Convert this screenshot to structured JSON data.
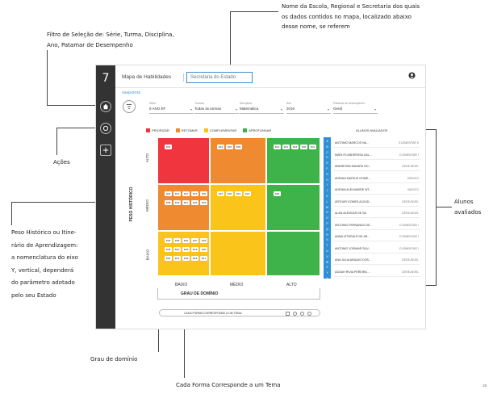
{
  "annotations": {
    "top_right": [
      "Nome da Escola, Regional e Secretaria dos quais",
      "os dados contidos no mapa, localizado abaixo",
      "desse nome, se referem"
    ],
    "top_left": [
      "Filtro de Seleção de: Série, Turma, Disciplina,",
      "Ano, Patamar de Desempenho"
    ],
    "acoes": "Ações",
    "alunos": [
      "Alunos",
      "avaliados"
    ],
    "peso": [
      "Peso Histórico ou Itine-",
      "rário de Aprendizagem:",
      "a nomenclatura do eixo",
      "Y, vertical, dependerá",
      "do parâmetro adotado",
      "pelo seu Estado"
    ],
    "grau": "Grau de domínio",
    "forma": "Cada Forma Corresponde a um Tema"
  },
  "app": {
    "logo": "7",
    "title": "Mapa de Habilidades",
    "school_placeholder": "Secretaria do Estado",
    "breadcrumb": "Saepe2016"
  },
  "filters": [
    {
      "label": "Série",
      "value": "9 ANO EF"
    },
    {
      "label": "Turmas",
      "value": "Todas as turmas"
    },
    {
      "label": "Disciplina",
      "value": "Matemática"
    },
    {
      "label": "Ano",
      "value": "2016"
    },
    {
      "label": "Patamar de desempenho",
      "value": "Geral"
    }
  ],
  "legend": [
    {
      "label": "PRIORIZAR",
      "color": "#f0353f"
    },
    {
      "label": "RETOMAR",
      "color": "#f08a30"
    },
    {
      "label": "COMPLEMENTAR",
      "color": "#fbc41b"
    },
    {
      "label": "APROFUNDAR",
      "color": "#3db34a"
    }
  ],
  "yaxis": {
    "title": "PESO HISTÓRICO",
    "ticks": [
      "ALTO",
      "MÉDIO",
      "BAIXO"
    ]
  },
  "xaxis": {
    "title": "GRAU DE DOMÍNIO",
    "ticks": [
      "BAIXO",
      "MÉDIO",
      "ALTO"
    ]
  },
  "cells": {
    "r0c0": {
      "color": "#f0353f",
      "badges": [
        "D43"
      ]
    },
    "r0c1": {
      "color": "#f08a30",
      "badges": [
        "D19",
        "D07",
        "D06"
      ]
    },
    "r0c2": {
      "color": "#3db34a",
      "badges": [
        "D14",
        "D13",
        "D16",
        "D36",
        "D41"
      ]
    },
    "r1c0": {
      "color": "#f08a30",
      "badges": [
        "D32",
        "D21",
        "D27",
        "D74",
        "D35",
        "D08",
        "D03",
        "D11",
        "D26",
        "D34"
      ]
    },
    "r1c1": {
      "color": "#fbc41b",
      "badges": [
        "D16",
        "D20",
        "D21",
        "D23"
      ]
    },
    "r1c2": {
      "color": "#3db34a",
      "badges": [
        "D05"
      ]
    },
    "r2c0": {
      "color": "#fbc41b",
      "badges": [
        "D36",
        "D08",
        "D02",
        "D07",
        "D28",
        "D38",
        "D30",
        "D33",
        "D19",
        "D30",
        "D30",
        "D13",
        "D39",
        "D18",
        "D17"
      ]
    },
    "r2c1": {
      "color": "#fbc41b",
      "badges": []
    },
    "r2c2": {
      "color": "#3db34a",
      "badges": []
    }
  },
  "shape_bar": "CADA FORMA CORRESPONDE A UM TEMA:",
  "students": {
    "header": "ALUNOS AVALIADOS",
    "alphabet": [
      "A",
      "B",
      "C",
      "D",
      "E",
      "F",
      "G",
      "H",
      "I",
      "J",
      "K",
      "L",
      "M",
      "N",
      "O",
      "P",
      "Q",
      "R",
      "S",
      "T",
      "U",
      "V",
      "W",
      "X",
      "Y",
      "Z"
    ],
    "rows": [
      {
        "name": "ANTONIO MARCOS NU...",
        "level": "ELEMENTAR II"
      },
      {
        "name": "MARLYS ANDRESSA DAL...",
        "level": "ELEMENTAR I"
      },
      {
        "name": "ANDRESSA MAYARA GO...",
        "level": "DESEJÁVEL"
      },
      {
        "name": "ADRIAN MATEUS GOME...",
        "level": "BÁSICO"
      },
      {
        "name": "ADRIAN ALEXANDRE WT...",
        "level": "BÁSICO"
      },
      {
        "name": "ARTHUR GOMES ALDUD...",
        "level": "DESEJÁVEL"
      },
      {
        "name": "ALAN ALENCAR DE SA",
        "level": "DESEJÁVEL"
      },
      {
        "name": "ANTONIO FERNANDO DE...",
        "level": "ELEMENTAR I"
      },
      {
        "name": "ANNA VITÓRIA R DE AR...",
        "level": "ELEMENTAR I"
      },
      {
        "name": "ANTONIO JOSIMAR SILV...",
        "level": "ELEMENTAR I"
      },
      {
        "name": "ANA JÚLIA ARAÚJO DOS...",
        "level": "DESEJÁVEL"
      },
      {
        "name": "AGDAH RIVIA PEREIRA ...",
        "level": "DESEJÁVEL"
      }
    ]
  },
  "page_number": "18"
}
